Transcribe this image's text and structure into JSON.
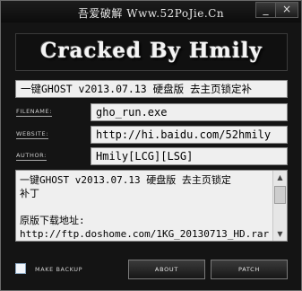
{
  "window": {
    "title": "吾爱破解 Www.52PoJie.Cn",
    "minimize_glyph": "_",
    "close_glyph": "×"
  },
  "banner": {
    "text": "Cracked By Hmily"
  },
  "caption": "一键GHOST v2013.07.13 硬盘版 去主页锁定补",
  "fields": {
    "filename_label": "FILENAME:",
    "filename_value": "gho_run.exe",
    "website_label": "WEBSITE:",
    "website_value": "http://hi.baidu.com/52hmily",
    "author_label": "AUTHOR:",
    "author_value": "Hmily[LCG][LSG]"
  },
  "notes": {
    "text": "一键GHOST v2013.07.13 硬盘版 去主页锁定\n补丁\n\n原版下载地址:\nhttp://ftp.doshome.com/1KG_20130713_HD.rar"
  },
  "scrollbar": {
    "up_icon": "▲",
    "down_icon": "▼"
  },
  "footer": {
    "make_backup_label": "MAKE BACKUP",
    "make_backup_checked": false,
    "about_label": "ABOUT",
    "patch_label": "PATCH"
  }
}
